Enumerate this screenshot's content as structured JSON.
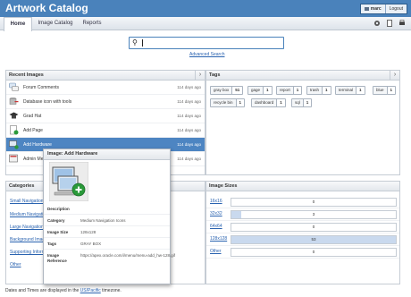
{
  "app": {
    "title": "Artwork Catalog"
  },
  "user": {
    "name": "marc",
    "logout": "Logout"
  },
  "tabs": [
    {
      "label": "Home",
      "active": true
    },
    {
      "label": "Image Catalog",
      "active": false
    },
    {
      "label": "Reports",
      "active": false
    }
  ],
  "search": {
    "value": "",
    "advanced_link": "Advanced Search"
  },
  "recent_images": {
    "title": "Recent Images",
    "items": [
      {
        "name": "Forum Comments",
        "date": "114 days ago"
      },
      {
        "name": "Database icon with tools",
        "date": "114 days ago"
      },
      {
        "name": "Grad Hat",
        "date": "114 days ago"
      },
      {
        "name": "Add Page",
        "date": "114 days ago"
      },
      {
        "name": "Add Hardware",
        "date": "114 days ago"
      },
      {
        "name": "Admin Me",
        "date": "114 days ago"
      }
    ]
  },
  "tags_panel": {
    "title": "Tags",
    "tags": [
      {
        "label": "gray box",
        "count": "51"
      },
      {
        "label": "gage",
        "count": "1"
      },
      {
        "label": "report",
        "count": "1"
      },
      {
        "label": "trash",
        "count": "1"
      },
      {
        "label": "terminal",
        "count": "1"
      },
      {
        "label": "blue",
        "count": "1"
      },
      {
        "label": "recycle bin",
        "count": "1"
      },
      {
        "label": "dashboard",
        "count": "1"
      },
      {
        "label": "sql",
        "count": "1"
      }
    ]
  },
  "categories": {
    "title": "Categories",
    "items": [
      "Small Navigation",
      "Medium Navigation",
      "Large Navigation",
      "Background Image",
      "Supporting Inform",
      "Other"
    ]
  },
  "image_sizes": {
    "title": "Image Sizes",
    "rows": [
      {
        "label": "16x16",
        "count": 0,
        "fill": 0
      },
      {
        "label": "32x32",
        "count": 3,
        "fill": 0.06
      },
      {
        "label": "64x64",
        "count": 0,
        "fill": 0
      },
      {
        "label": "128x128",
        "count": 53,
        "fill": 1.0
      },
      {
        "label": "Other",
        "count": 0,
        "fill": 0
      }
    ]
  },
  "popup": {
    "title": "Image: Add Hardware",
    "rows": [
      {
        "key": "Description",
        "value": ""
      },
      {
        "key": "Category",
        "value": "Medium Navigation Icons"
      },
      {
        "key": "Image Size",
        "value": "128x128"
      },
      {
        "key": "Tags",
        "value": "GRAY BOX"
      },
      {
        "key": "Image Reference",
        "value": "https://apex.oracle.com/i/menu/menu-add_hw-128.gif"
      }
    ]
  },
  "footer": {
    "prefix": "Dates and Times are displayed in the",
    "tz": "US/Pacific",
    "suffix": "timezone."
  },
  "colors": {
    "header": "#4a82bb",
    "selected_row": "#4d85c2",
    "link": "#2a63b0"
  }
}
